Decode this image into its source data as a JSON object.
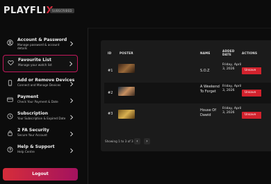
{
  "app": {
    "logo_prefix": "PLAYFLI",
    "logo_x": "X",
    "badge": "SUBSCRIBED"
  },
  "sidebar": {
    "items": [
      {
        "title": "Account & Password",
        "subtitle": "Manage password & account details",
        "icon": "user-icon"
      },
      {
        "title": "Favourite List",
        "subtitle": "Manage your watch list",
        "icon": "heart-icon",
        "active": true
      },
      {
        "title": "Add or Remove Devices",
        "subtitle": "Connect and Manage Devices",
        "icon": "device-icon"
      },
      {
        "title": "Payment",
        "subtitle": "Check Your Payment & Date",
        "icon": "card-icon"
      },
      {
        "title": "Subscription",
        "subtitle": "Your Subscription & Expired Date",
        "icon": "subscription-icon"
      },
      {
        "title": "2 FA Security",
        "subtitle": "Secure Your Account",
        "icon": "lock-icon"
      },
      {
        "title": "Help & Support",
        "subtitle": "Help Centre",
        "icon": "help-icon"
      }
    ],
    "logout_label": "Logout"
  },
  "table": {
    "headers": {
      "id": "ID",
      "poster": "POSTER",
      "name": "NAME",
      "added_date": "ADDED DATE",
      "actions": "ACTIONS"
    },
    "rows": [
      {
        "id": "#1",
        "name": "S.O.Z",
        "date": "Friday, April 3, 2026",
        "action": "Unsave"
      },
      {
        "id": "#2",
        "name": "A Weekend To Forget",
        "date": "Friday, April 3, 2026",
        "action": "Unsave"
      },
      {
        "id": "#3",
        "name": "House Of Dawid",
        "date": "Friday, April 3, 2026",
        "action": "Unsave"
      }
    ],
    "footer": "Showing 1 to 3 of 3",
    "prev": "‹",
    "next": "›"
  }
}
